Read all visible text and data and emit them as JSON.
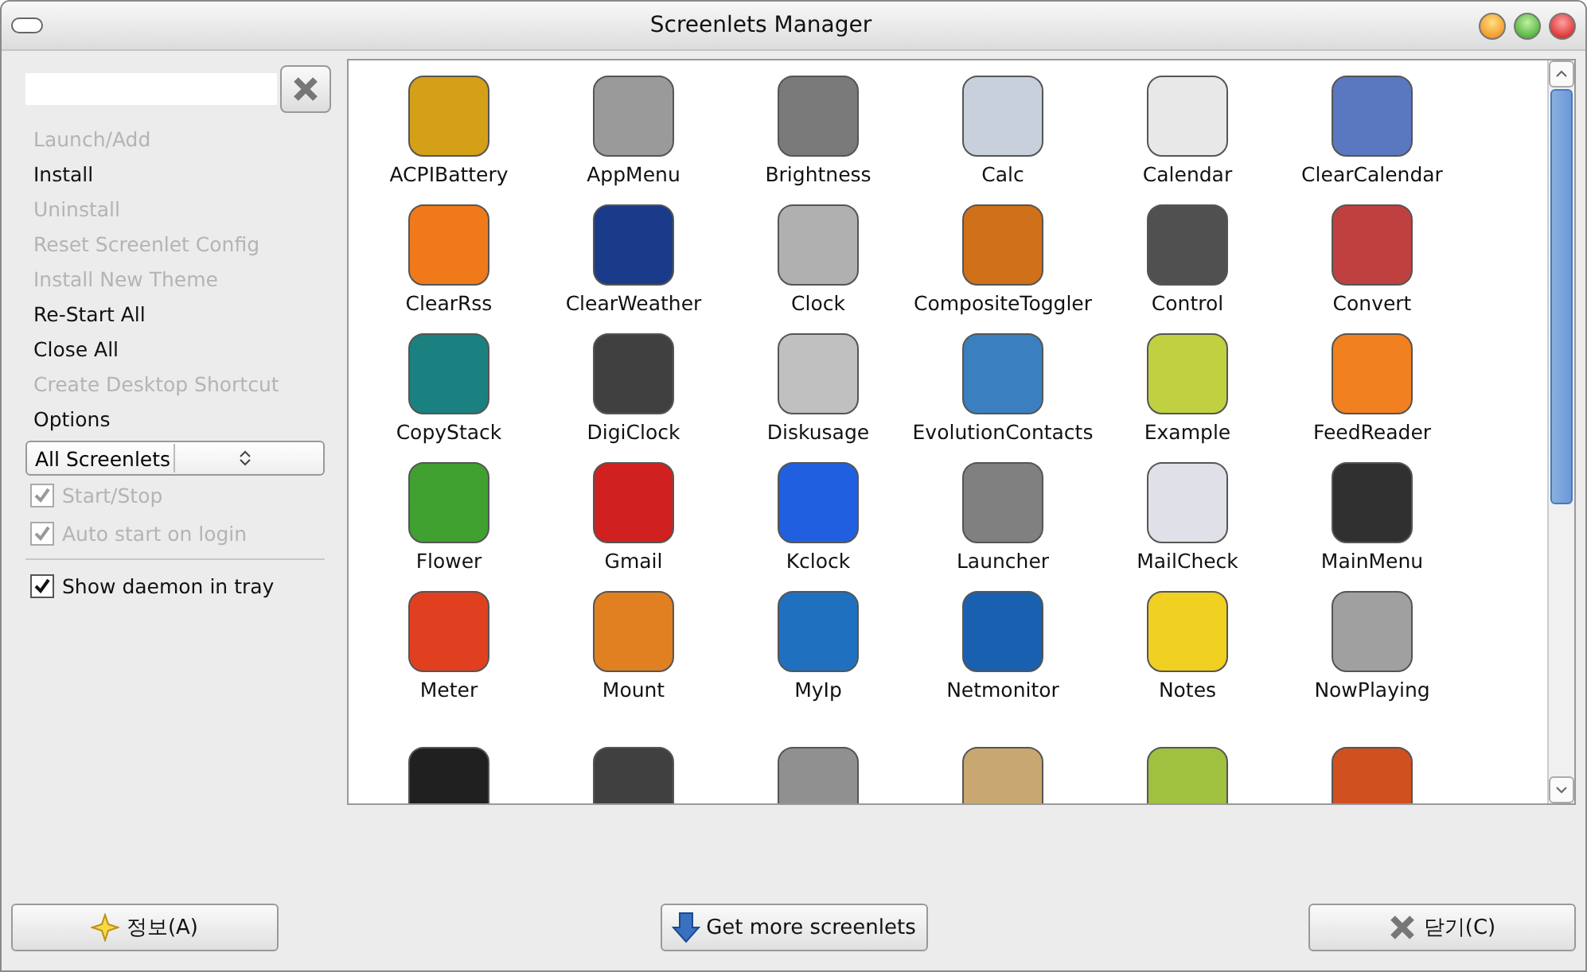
{
  "window": {
    "title": "Screenlets Manager"
  },
  "actions": [
    {
      "label": "Launch/Add",
      "disabled": true
    },
    {
      "label": "Install",
      "disabled": false
    },
    {
      "label": "Uninstall",
      "disabled": true
    },
    {
      "label": "Reset Screenlet Config",
      "disabled": true
    },
    {
      "label": "Install New Theme",
      "disabled": true
    },
    {
      "label": "Re-Start All",
      "disabled": false
    },
    {
      "label": "Close All",
      "disabled": false
    },
    {
      "label": "Create Desktop Shortcut",
      "disabled": true
    }
  ],
  "options_label": "Options",
  "filter": {
    "value": "All Screenlets"
  },
  "checks": [
    {
      "label": "Start/Stop",
      "checked": true,
      "disabled": true
    },
    {
      "label": "Auto start on login",
      "checked": true,
      "disabled": true
    },
    {
      "label": "Show daemon in tray",
      "checked": true,
      "disabled": false
    }
  ],
  "screenlets": [
    {
      "label": "ACPIBattery",
      "color": "#d4a017"
    },
    {
      "label": "AppMenu",
      "color": "#9a9a9a"
    },
    {
      "label": "Brightness",
      "color": "#7a7a7a"
    },
    {
      "label": "Calc",
      "color": "#c8d0dc"
    },
    {
      "label": "Calendar",
      "color": "#e8e8e8"
    },
    {
      "label": "ClearCalendar",
      "color": "#5a78c0"
    },
    {
      "label": "ClearRss",
      "color": "#f07a1a"
    },
    {
      "label": "ClearWeather",
      "color": "#1a3a8a"
    },
    {
      "label": "Clock",
      "color": "#b0b0b0"
    },
    {
      "label": "CompositeToggler",
      "color": "#d0701a"
    },
    {
      "label": "Control",
      "color": "#505050"
    },
    {
      "label": "Convert",
      "color": "#c04040"
    },
    {
      "label": "CopyStack",
      "color": "#1a8080"
    },
    {
      "label": "DigiClock",
      "color": "#404040"
    },
    {
      "label": "Diskusage",
      "color": "#c0c0c0"
    },
    {
      "label": "EvolutionContacts",
      "color": "#3a80c0"
    },
    {
      "label": "Example",
      "color": "#c0d040"
    },
    {
      "label": "FeedReader",
      "color": "#f08020"
    },
    {
      "label": "Flower",
      "color": "#40a030"
    },
    {
      "label": "Gmail",
      "color": "#d02020"
    },
    {
      "label": "Kclock",
      "color": "#2060e0"
    },
    {
      "label": "Launcher",
      "color": "#808080"
    },
    {
      "label": "MailCheck",
      "color": "#e0e0e8"
    },
    {
      "label": "MainMenu",
      "color": "#303030"
    },
    {
      "label": "Meter",
      "color": "#e04020"
    },
    {
      "label": "Mount",
      "color": "#e08020"
    },
    {
      "label": "MyIp",
      "color": "#2070c0"
    },
    {
      "label": "Netmonitor",
      "color": "#1a60b0"
    },
    {
      "label": "Notes",
      "color": "#f0d020"
    },
    {
      "label": "NowPlaying",
      "color": "#a0a0a0"
    },
    {
      "color": "#202020"
    },
    {
      "color": "#404040"
    },
    {
      "color": "#909090"
    },
    {
      "color": "#c8a870"
    },
    {
      "color": "#a0c040"
    },
    {
      "color": "#d05020"
    }
  ],
  "buttons": [
    {
      "kind": "about",
      "label": "정보(A)"
    },
    {
      "kind": "download",
      "label": "Get more screenlets"
    },
    {
      "kind": "close",
      "label": "닫기(C)"
    }
  ]
}
